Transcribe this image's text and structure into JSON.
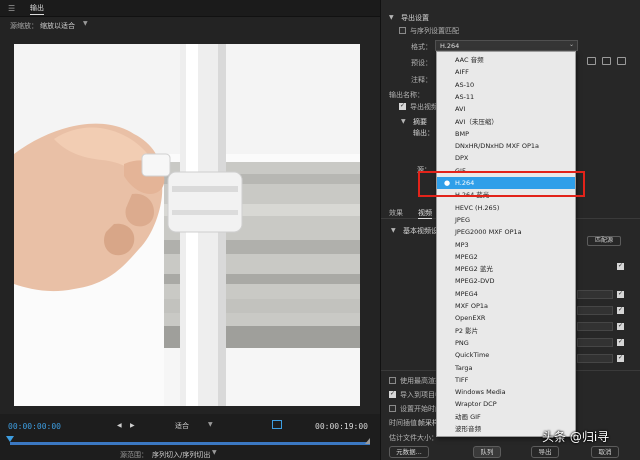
{
  "app": {
    "menu_icon": "hamburger-icon",
    "tab_export": "输出",
    "source_scaling_label": "源缩放：",
    "source_scaling_value": "缩放以适合"
  },
  "timeline": {
    "timecode_in": "00:00:00:00",
    "timecode_out": "00:00:19:00",
    "fit_value": "适合",
    "source_range_label": "源范围：",
    "source_range_value": "序列切入/序列切出"
  },
  "export_settings": {
    "title": "导出设置",
    "match_sequence": "与序列设置匹配",
    "format_label": "格式：",
    "format_value": "H.264",
    "preset_label": "预设：",
    "comments_label": "注释：",
    "output_name_label": "输出名称：",
    "export_video": "导出视频",
    "summary_title": "摘要",
    "output_label": "输出：",
    "source_label": "源："
  },
  "tabs": {
    "effects": "效果",
    "video": "视频"
  },
  "video_section": {
    "title": "基本视频设置",
    "match_source_button": "匹配源"
  },
  "bottom_options": {
    "use_max_render": "使用最高渲染质量",
    "import_into_project": "导入到项目中",
    "set_start_timecode": "设置开始时间码",
    "time_interpolation_label": "时间插值：",
    "time_interpolation_value": "帧采样",
    "estimated_size_label": "估计文件大小："
  },
  "footer": {
    "metadata_button": "元数据...",
    "queue_button": "队列",
    "export_button": "导出",
    "cancel_button": "取消"
  },
  "format_dropdown": {
    "selected": "H.264",
    "items": [
      "AAC 音频",
      "AIFF",
      "AS-10",
      "AS-11",
      "AVI",
      "AVI（未压缩）",
      "BMP",
      "DNxHR/DNxHD MXF OP1a",
      "DPX",
      "GIF",
      "H.264",
      "H.264 蓝光",
      "HEVC (H.265)",
      "JPEG",
      "JPEG2000 MXF OP1a",
      "MP3",
      "MPEG2",
      "MPEG2 蓝光",
      "MPEG2-DVD",
      "MPEG4",
      "MXF OP1a",
      "OpenEXR",
      "P2 影片",
      "PNG",
      "QuickTime",
      "Targa",
      "TIFF",
      "Windows Media",
      "Wraptor DCP",
      "动画 GIF",
      "波形音频"
    ]
  },
  "watermark": "头条 @归i寻",
  "colors": {
    "accent_blue": "#2f9fe9",
    "highlight_red": "#e2231a",
    "timecode_blue": "#3d9de0"
  }
}
